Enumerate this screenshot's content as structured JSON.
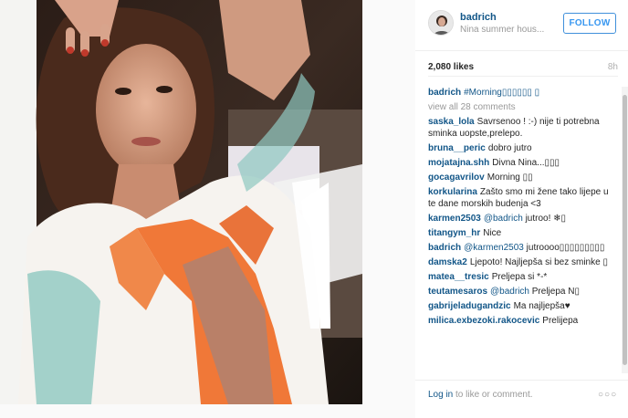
{
  "post": {
    "owner": "badrich",
    "location": "Nina summer hous...",
    "follow_label": "FOLLOW",
    "likes": "2,080 likes",
    "time_ago": "8h"
  },
  "caption": {
    "user": "badrich",
    "text": "#Morning▯▯▯▯▯▯ ▯"
  },
  "view_all": "view all 28 comments",
  "comments": [
    {
      "user": "saska_lola",
      "text": "Savrsenoo ! :-) nije ti potrebna sminka uopste,prelepo."
    },
    {
      "user": "bruna__peric",
      "text": "dobro jutro"
    },
    {
      "user": "mojatajna.shh",
      "text": "Divna Nina...▯▯▯"
    },
    {
      "user": "gocagavrilov",
      "text": "Morning ▯▯"
    },
    {
      "user": "korkularina",
      "text": "Zašto smo mi žene tako lijepe u te dane morskih budenja <3"
    },
    {
      "user": "karmen2503",
      "mention": "@badrich",
      "text": "jutroo! ❄▯"
    },
    {
      "user": "titangym_hr",
      "text": "Nice"
    },
    {
      "user": "badrich",
      "mention": "@karmen2503",
      "text": "jutroooo▯▯▯▯▯▯▯▯▯"
    },
    {
      "user": "damska2",
      "text": "Ljepoto! Najljepša si bez sminke ▯"
    },
    {
      "user": "matea__tresic",
      "text": "Preljepa si *-*"
    },
    {
      "user": "teutamesaros",
      "mention": "@badrich",
      "text": "Preljepa N▯"
    },
    {
      "user": "gabrijeladugandzic",
      "text": "Ma najljepša♥"
    },
    {
      "user": "milica.exbezoki.rakocevic",
      "text": "Prelijepa"
    }
  ],
  "footer": {
    "login_link": "Log in",
    "login_rest": " to like or comment.",
    "more": "○○○"
  },
  "colors": {
    "link": "#125688",
    "follow": "#3897f0",
    "muted": "#999999"
  },
  "icons": [
    "avatar",
    "more-options-icon"
  ]
}
